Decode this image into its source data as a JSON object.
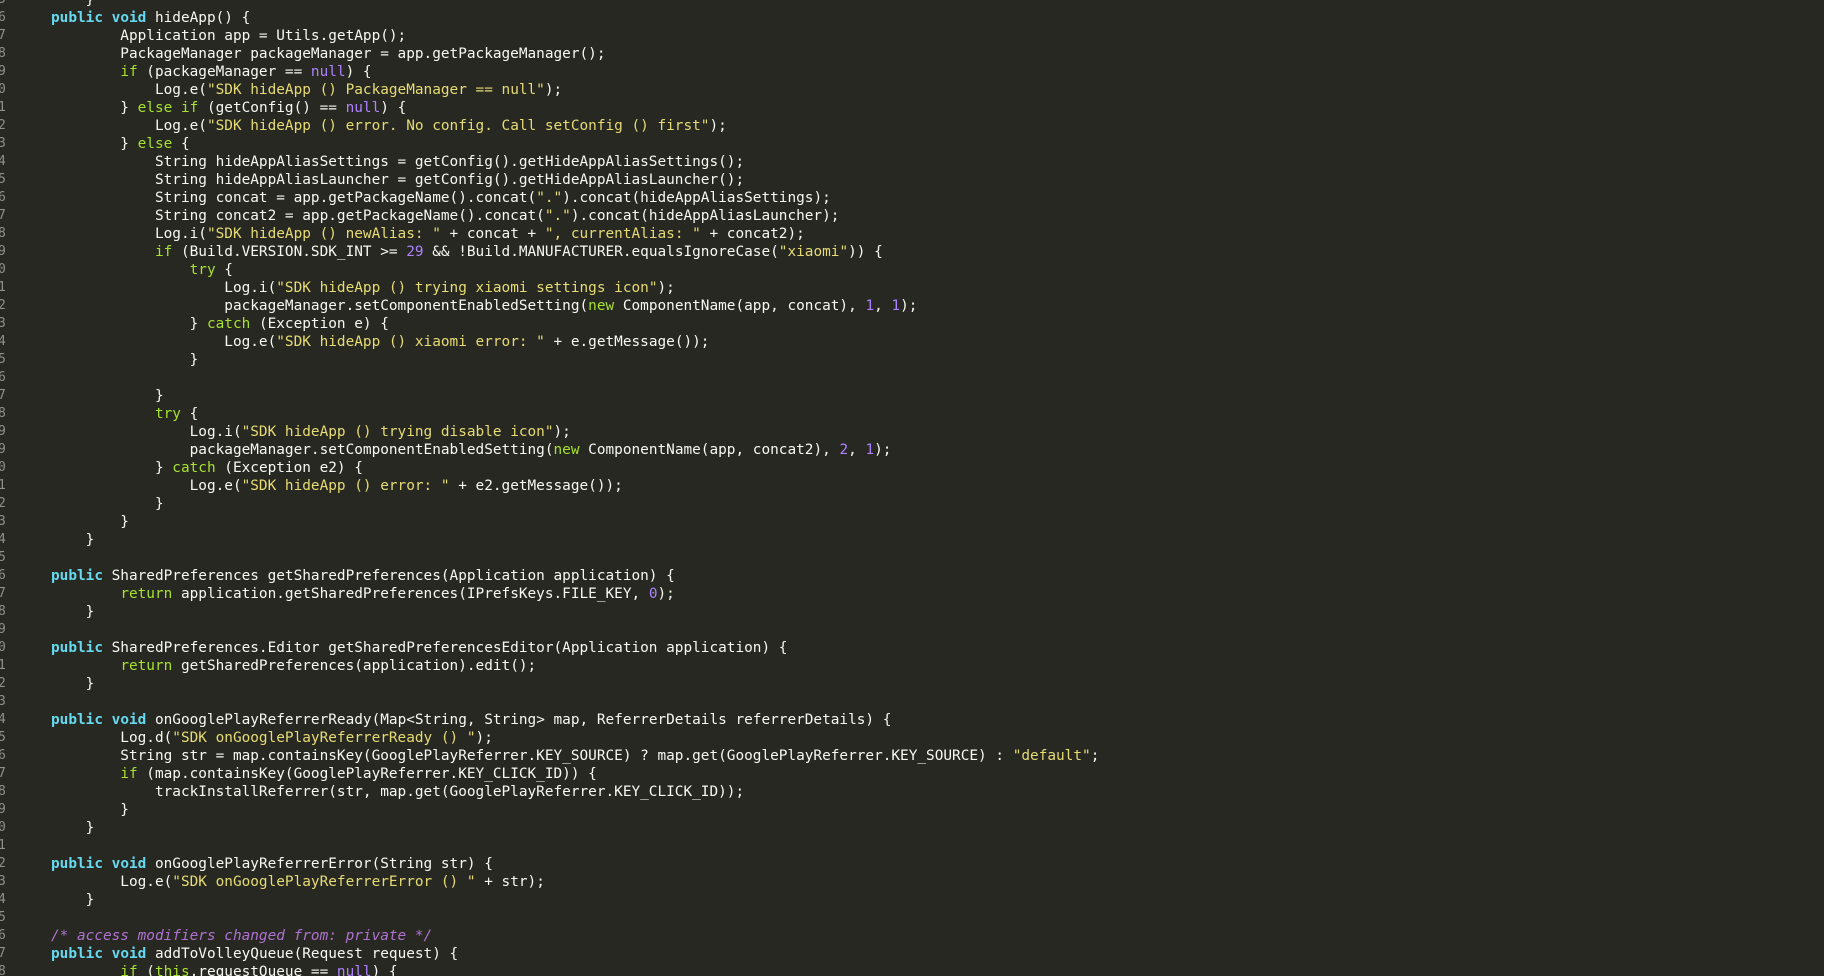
{
  "editor": {
    "colors": {
      "background": "#272822",
      "text": "#f8f8f2",
      "gutter": "#8f908a",
      "keyword": "#66d9ef",
      "control": "#a6e22e",
      "literal": "#ae81ff",
      "string": "#e6db74",
      "number": "#ae81ff",
      "comment": "#b072d1"
    },
    "lines": [
      {
        "n": "5",
        "tokens": [
          [
            "pl",
            "    }"
          ]
        ]
      },
      {
        "n": "6",
        "tokens": [
          [
            "kw",
            "public"
          ],
          [
            "pl",
            " "
          ],
          [
            "kw",
            "void"
          ],
          [
            "pl",
            " hideApp() {"
          ]
        ]
      },
      {
        "n": "7",
        "tokens": [
          [
            "pl",
            "        Application app = Utils.getApp();"
          ]
        ]
      },
      {
        "n": "8",
        "tokens": [
          [
            "pl",
            "        PackageManager packageManager = app.getPackageManager();"
          ]
        ]
      },
      {
        "n": "9",
        "tokens": [
          [
            "pl",
            "        "
          ],
          [
            "ctl",
            "if"
          ],
          [
            "pl",
            " (packageManager == "
          ],
          [
            "lit",
            "null"
          ],
          [
            "pl",
            ") {"
          ]
        ]
      },
      {
        "n": "0",
        "tokens": [
          [
            "pl",
            "            Log.e("
          ],
          [
            "str",
            "\"SDK hideApp () PackageManager == null\""
          ],
          [
            "pl",
            ");"
          ]
        ]
      },
      {
        "n": "1",
        "tokens": [
          [
            "pl",
            "        } "
          ],
          [
            "ctl",
            "else if"
          ],
          [
            "pl",
            " (getConfig() == "
          ],
          [
            "lit",
            "null"
          ],
          [
            "pl",
            ") {"
          ]
        ]
      },
      {
        "n": "2",
        "tokens": [
          [
            "pl",
            "            Log.e("
          ],
          [
            "str",
            "\"SDK hideApp () error. No config. Call setConfig () first\""
          ],
          [
            "pl",
            ");"
          ]
        ]
      },
      {
        "n": "3",
        "tokens": [
          [
            "pl",
            "        } "
          ],
          [
            "ctl",
            "else"
          ],
          [
            "pl",
            " {"
          ]
        ]
      },
      {
        "n": "4",
        "tokens": [
          [
            "pl",
            "            String hideAppAliasSettings = getConfig().getHideAppAliasSettings();"
          ]
        ]
      },
      {
        "n": "5",
        "tokens": [
          [
            "pl",
            "            String hideAppAliasLauncher = getConfig().getHideAppAliasLauncher();"
          ]
        ]
      },
      {
        "n": "6",
        "tokens": [
          [
            "pl",
            "            String concat = app.getPackageName().concat("
          ],
          [
            "str",
            "\".\""
          ],
          [
            "pl",
            ").concat(hideAppAliasSettings);"
          ]
        ]
      },
      {
        "n": "7",
        "tokens": [
          [
            "pl",
            "            String concat2 = app.getPackageName().concat("
          ],
          [
            "str",
            "\".\""
          ],
          [
            "pl",
            ").concat(hideAppAliasLauncher);"
          ]
        ]
      },
      {
        "n": "8",
        "tokens": [
          [
            "pl",
            "            Log.i("
          ],
          [
            "str",
            "\"SDK hideApp () newAlias: \""
          ],
          [
            "pl",
            " + concat + "
          ],
          [
            "str",
            "\", currentAlias: \""
          ],
          [
            "pl",
            " + concat2);"
          ]
        ]
      },
      {
        "n": "9",
        "tokens": [
          [
            "pl",
            "            "
          ],
          [
            "ctl",
            "if"
          ],
          [
            "pl",
            " (Build.VERSION.SDK_INT >= "
          ],
          [
            "num",
            "29"
          ],
          [
            "pl",
            " && !Build.MANUFACTURER.equalsIgnoreCase("
          ],
          [
            "str",
            "\"xiaomi\""
          ],
          [
            "pl",
            ")) {"
          ]
        ]
      },
      {
        "n": "0",
        "tokens": [
          [
            "pl",
            "                "
          ],
          [
            "ctl",
            "try"
          ],
          [
            "pl",
            " {"
          ]
        ]
      },
      {
        "n": "1",
        "tokens": [
          [
            "pl",
            "                    Log.i("
          ],
          [
            "str",
            "\"SDK hideApp () trying xiaomi settings icon\""
          ],
          [
            "pl",
            ");"
          ]
        ]
      },
      {
        "n": "2",
        "tokens": [
          [
            "pl",
            "                    packageManager.setComponentEnabledSetting("
          ],
          [
            "ctl",
            "new"
          ],
          [
            "pl",
            " ComponentName(app, concat), "
          ],
          [
            "num",
            "1"
          ],
          [
            "pl",
            ", "
          ],
          [
            "num",
            "1"
          ],
          [
            "pl",
            ");"
          ]
        ]
      },
      {
        "n": "3",
        "tokens": [
          [
            "pl",
            "                } "
          ],
          [
            "ctl",
            "catch"
          ],
          [
            "pl",
            " (Exception e) {"
          ]
        ]
      },
      {
        "n": "4",
        "tokens": [
          [
            "pl",
            "                    Log.e("
          ],
          [
            "str",
            "\"SDK hideApp () xiaomi error: \""
          ],
          [
            "pl",
            " + e.getMessage());"
          ]
        ]
      },
      {
        "n": "5",
        "tokens": [
          [
            "pl",
            "                }"
          ]
        ]
      },
      {
        "n": "6",
        "tokens": [
          [
            "pl",
            ""
          ]
        ]
      },
      {
        "n": "7",
        "tokens": [
          [
            "pl",
            "            }"
          ]
        ]
      },
      {
        "n": "8",
        "tokens": [
          [
            "pl",
            "            "
          ],
          [
            "ctl",
            "try"
          ],
          [
            "pl",
            " {"
          ]
        ]
      },
      {
        "n": "9",
        "tokens": [
          [
            "pl",
            "                Log.i("
          ],
          [
            "str",
            "\"SDK hideApp () trying disable icon\""
          ],
          [
            "pl",
            ");"
          ]
        ]
      },
      {
        "n": "9",
        "tokens": [
          [
            "pl",
            "                packageManager.setComponentEnabledSetting("
          ],
          [
            "ctl",
            "new"
          ],
          [
            "pl",
            " ComponentName(app, concat2), "
          ],
          [
            "num",
            "2"
          ],
          [
            "pl",
            ", "
          ],
          [
            "num",
            "1"
          ],
          [
            "pl",
            ");"
          ]
        ]
      },
      {
        "n": "0",
        "tokens": [
          [
            "pl",
            "            } "
          ],
          [
            "ctl",
            "catch"
          ],
          [
            "pl",
            " (Exception e2) {"
          ]
        ]
      },
      {
        "n": "1",
        "tokens": [
          [
            "pl",
            "                Log.e("
          ],
          [
            "str",
            "\"SDK hideApp () error: \""
          ],
          [
            "pl",
            " + e2.getMessage());"
          ]
        ]
      },
      {
        "n": "2",
        "tokens": [
          [
            "pl",
            "            }"
          ]
        ]
      },
      {
        "n": "3",
        "tokens": [
          [
            "pl",
            "        }"
          ]
        ]
      },
      {
        "n": "4",
        "tokens": [
          [
            "pl",
            "    }"
          ]
        ]
      },
      {
        "n": "5",
        "tokens": [
          [
            "pl",
            ""
          ]
        ]
      },
      {
        "n": "6",
        "tokens": [
          [
            "kw",
            "public"
          ],
          [
            "pl",
            " SharedPreferences getSharedPreferences(Application application) {"
          ]
        ]
      },
      {
        "n": "7",
        "tokens": [
          [
            "pl",
            "        "
          ],
          [
            "ctl",
            "return"
          ],
          [
            "pl",
            " application.getSharedPreferences(IPrefsKeys.FILE_KEY, "
          ],
          [
            "num",
            "0"
          ],
          [
            "pl",
            ");"
          ]
        ]
      },
      {
        "n": "8",
        "tokens": [
          [
            "pl",
            "    }"
          ]
        ]
      },
      {
        "n": "9",
        "tokens": [
          [
            "pl",
            ""
          ]
        ]
      },
      {
        "n": "0",
        "tokens": [
          [
            "kw",
            "public"
          ],
          [
            "pl",
            " SharedPreferences.Editor getSharedPreferencesEditor(Application application) {"
          ]
        ]
      },
      {
        "n": "1",
        "tokens": [
          [
            "pl",
            "        "
          ],
          [
            "ctl",
            "return"
          ],
          [
            "pl",
            " getSharedPreferences(application).edit();"
          ]
        ]
      },
      {
        "n": "2",
        "tokens": [
          [
            "pl",
            "    }"
          ]
        ]
      },
      {
        "n": "3",
        "tokens": [
          [
            "pl",
            ""
          ]
        ]
      },
      {
        "n": "4",
        "tokens": [
          [
            "kw",
            "public"
          ],
          [
            "pl",
            " "
          ],
          [
            "kw",
            "void"
          ],
          [
            "pl",
            " onGooglePlayReferrerReady(Map<String, String> map, ReferrerDetails referrerDetails) {"
          ]
        ]
      },
      {
        "n": "5",
        "tokens": [
          [
            "pl",
            "        Log.d("
          ],
          [
            "str",
            "\"SDK onGooglePlayReferrerReady () \""
          ],
          [
            "pl",
            ");"
          ]
        ]
      },
      {
        "n": "6",
        "tokens": [
          [
            "pl",
            "        String str = map.containsKey(GooglePlayReferrer.KEY_SOURCE) ? map.get(GooglePlayReferrer.KEY_SOURCE) : "
          ],
          [
            "str",
            "\"default\""
          ],
          [
            "pl",
            ";"
          ]
        ]
      },
      {
        "n": "7",
        "tokens": [
          [
            "pl",
            "        "
          ],
          [
            "ctl",
            "if"
          ],
          [
            "pl",
            " (map.containsKey(GooglePlayReferrer.KEY_CLICK_ID)) {"
          ]
        ]
      },
      {
        "n": "8",
        "tokens": [
          [
            "pl",
            "            trackInstallReferrer(str, map.get(GooglePlayReferrer.KEY_CLICK_ID));"
          ]
        ]
      },
      {
        "n": "9",
        "tokens": [
          [
            "pl",
            "        }"
          ]
        ]
      },
      {
        "n": "0",
        "tokens": [
          [
            "pl",
            "    }"
          ]
        ]
      },
      {
        "n": "1",
        "tokens": [
          [
            "pl",
            ""
          ]
        ]
      },
      {
        "n": "2",
        "tokens": [
          [
            "kw",
            "public"
          ],
          [
            "pl",
            " "
          ],
          [
            "kw",
            "void"
          ],
          [
            "pl",
            " onGooglePlayReferrerError(String str) {"
          ]
        ]
      },
      {
        "n": "3",
        "tokens": [
          [
            "pl",
            "        Log.e("
          ],
          [
            "str",
            "\"SDK onGooglePlayReferrerError () \""
          ],
          [
            "pl",
            " + str);"
          ]
        ]
      },
      {
        "n": "4",
        "tokens": [
          [
            "pl",
            "    }"
          ]
        ]
      },
      {
        "n": "5",
        "tokens": [
          [
            "pl",
            ""
          ]
        ]
      },
      {
        "n": "6",
        "tokens": [
          [
            "cm",
            "/* access modifiers changed from: private */"
          ]
        ]
      },
      {
        "n": "7",
        "tokens": [
          [
            "kw",
            "public"
          ],
          [
            "pl",
            " "
          ],
          [
            "kw",
            "void"
          ],
          [
            "pl",
            " addToVolleyQueue(Request request) {"
          ]
        ]
      },
      {
        "n": "8",
        "tokens": [
          [
            "pl",
            "        "
          ],
          [
            "ctl",
            "if"
          ],
          [
            "pl",
            " ("
          ],
          [
            "ctl",
            "this"
          ],
          [
            "pl",
            ".requestQueue == "
          ],
          [
            "lit",
            "null"
          ],
          [
            "pl",
            ") {"
          ]
        ]
      }
    ]
  }
}
